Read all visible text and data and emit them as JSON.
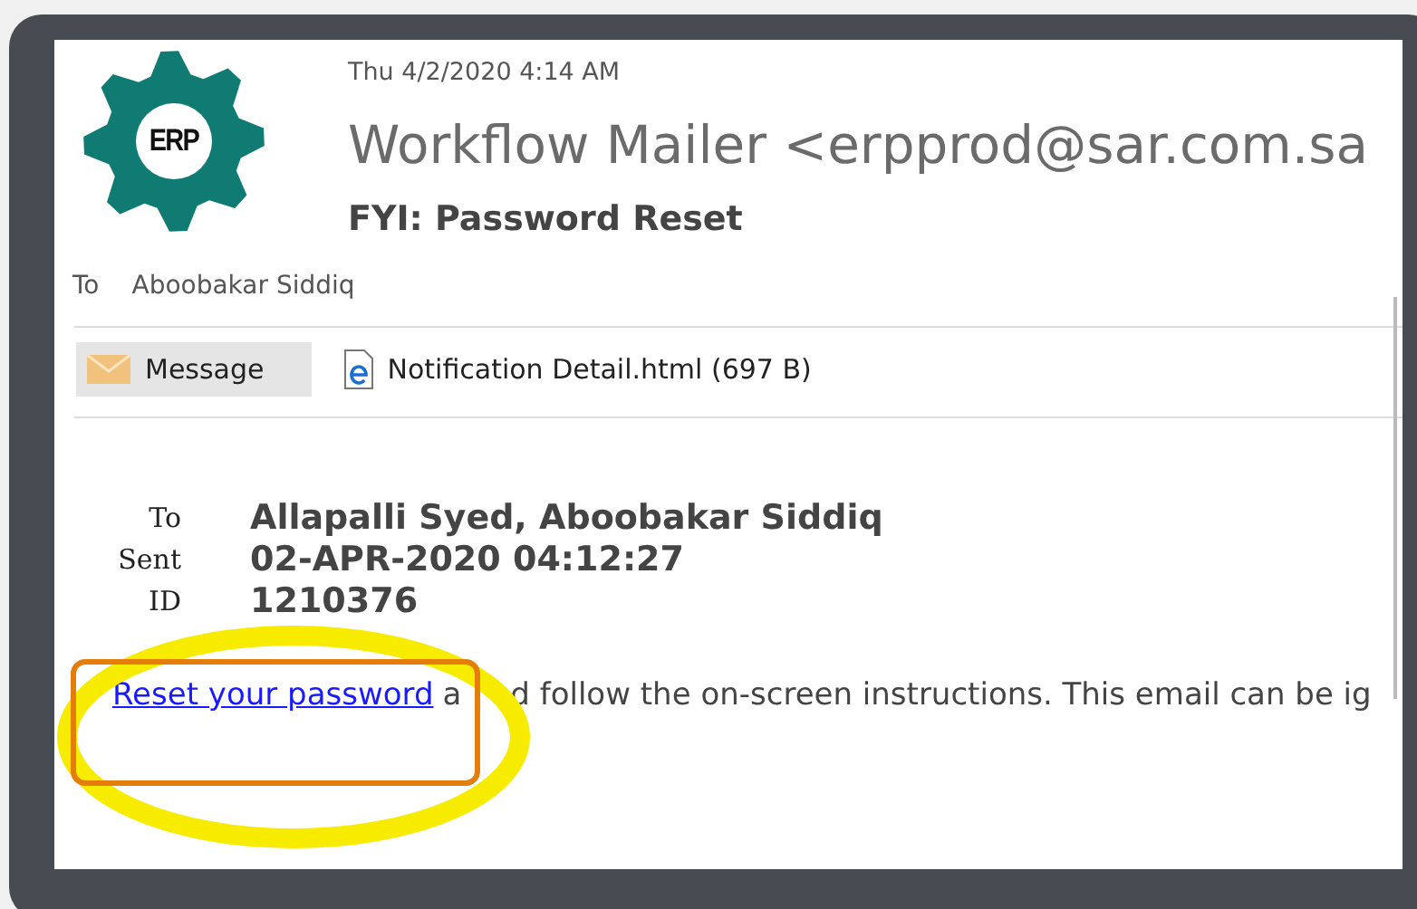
{
  "logo": {
    "text": "ERP"
  },
  "header": {
    "date": "Thu 4/2/2020 4:14 AM",
    "sender": "Workflow Mailer <erpprod@sar.com.sa",
    "subject": "FYI: Password Reset",
    "to_label": "To",
    "to": "Aboobakar Siddiq"
  },
  "tabs": [
    {
      "label": "Message",
      "kind": "message",
      "selected": true
    },
    {
      "label": "Notification Detail.html (697 B)",
      "kind": "attachment",
      "selected": false
    }
  ],
  "body": {
    "fields": [
      {
        "label": "To",
        "value": "Allapalli Syed, Aboobakar Siddiq"
      },
      {
        "label": "Sent",
        "value": "02-APR-2020 04:12:27"
      },
      {
        "label": "ID",
        "value": "1210376"
      }
    ],
    "link": "Reset your password",
    "text_parts": [
      "a",
      "d follow the on-screen instructions. This email can be ig"
    ]
  },
  "annotations": [
    {
      "kind": "ellipse",
      "color": "#f7ec00"
    },
    {
      "kind": "rect",
      "color": "#e47d0a"
    }
  ]
}
